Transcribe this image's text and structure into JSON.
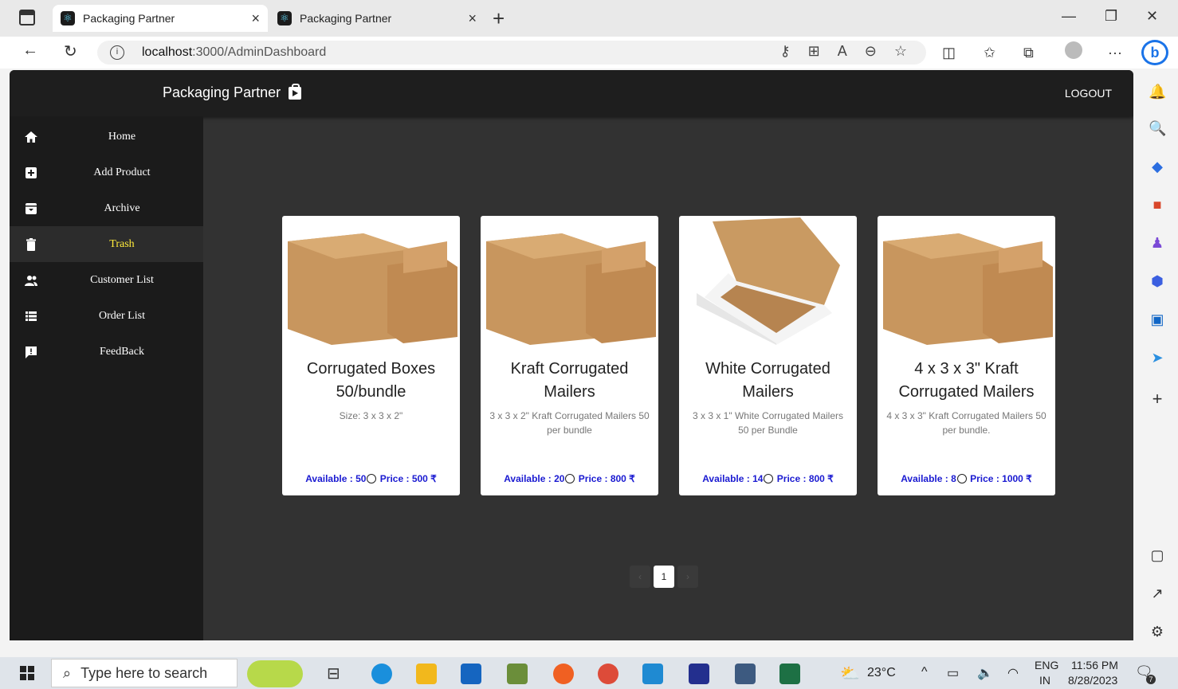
{
  "browser": {
    "tabs": [
      {
        "label": "Packaging Partner",
        "close": "×"
      },
      {
        "label": "Packaging Partner",
        "close": "×"
      }
    ],
    "new_tab": "+",
    "url_host": "localhost",
    "url_path": ":3000/AdminDashboard"
  },
  "app": {
    "brand": "Packaging Partner",
    "logout": "LOGOUT",
    "sidebar": [
      {
        "label": "Home",
        "icon": "home-icon"
      },
      {
        "label": "Add Product",
        "icon": "add-box-icon"
      },
      {
        "label": "Archive",
        "icon": "archive-icon"
      },
      {
        "label": "Trash",
        "icon": "trash-icon",
        "active": true
      },
      {
        "label": "Customer List",
        "icon": "people-icon"
      },
      {
        "label": "Order List",
        "icon": "list-icon"
      },
      {
        "label": "FeedBack",
        "icon": "feedback-icon"
      }
    ],
    "products": [
      {
        "title": "Corrugated Boxes 50/bundle",
        "desc": "Size: 3 x 3 x 2\"",
        "available": "Available : 50",
        "price": "Price : 500 ₹"
      },
      {
        "title": "Kraft Corrugated Mailers",
        "desc": "3 x 3 x 2\" Kraft Corrugated Mailers 50 per bundle",
        "available": "Available : 20",
        "price": "Price : 800 ₹"
      },
      {
        "title": "White Corrugated Mailers",
        "desc": "3 x 3 x 1\" White Corrugated Mailers 50 per Bundle",
        "available": "Available : 14",
        "price": "Price : 800 ₹"
      },
      {
        "title": "4 x 3 x 3\" Kraft Corrugated Mailers",
        "desc": "4 x 3 x 3\" Kraft Corrugated Mailers 50 per bundle.",
        "available": "Available : 8",
        "price": "Price : 1000 ₹"
      }
    ],
    "pagination": {
      "prev": "‹",
      "current": "1",
      "next": "›"
    }
  },
  "taskbar": {
    "search_placeholder": "Type here to search",
    "weather": "23°C",
    "lang_top": "ENG",
    "lang_bottom": "IN",
    "time": "11:56 PM",
    "date": "8/28/2023",
    "notifications": "7"
  }
}
